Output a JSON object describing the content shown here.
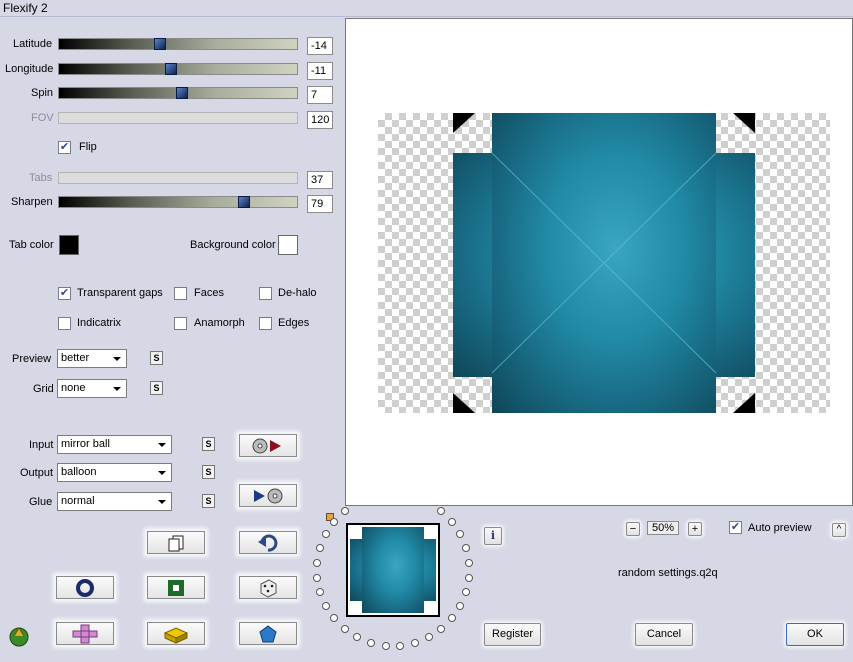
{
  "window": {
    "title": "Flexify 2"
  },
  "sliders": {
    "latitude": {
      "label": "Latitude",
      "value": "-14"
    },
    "longitude": {
      "label": "Longitude",
      "value": "-11"
    },
    "spin": {
      "label": "Spin",
      "value": "7"
    },
    "fov": {
      "label": "FOV",
      "value": "120"
    },
    "tabs": {
      "label": "Tabs",
      "value": "37"
    },
    "sharpen": {
      "label": "Sharpen",
      "value": "79"
    }
  },
  "flip": {
    "label": "Flip",
    "checked": true
  },
  "colors": {
    "tab_color_label": "Tab color",
    "tab_color": "#000000",
    "background_color_label": "Background color",
    "background_color": "#ffffff"
  },
  "options": {
    "transparent_gaps": "Transparent gaps",
    "faces": "Faces",
    "de_halo": "De-halo",
    "indicatrix": "Indicatrix",
    "anamorph": "Anamorph",
    "edges": "Edges"
  },
  "preview_select": {
    "label": "Preview",
    "value": "better"
  },
  "grid_select": {
    "label": "Grid",
    "value": "none"
  },
  "input_select": {
    "label": "Input",
    "value": "mirror ball"
  },
  "output_select": {
    "label": "Output",
    "value": "balloon"
  },
  "glue_select": {
    "label": "Glue",
    "value": "normal"
  },
  "s_button_label": "S",
  "zoom": {
    "minus": "−",
    "value": "50%",
    "plus": "+"
  },
  "auto_preview": {
    "label": "Auto preview",
    "checked": true
  },
  "collapse_button": "^",
  "info_button": "i",
  "preset_name": "random settings.q2q",
  "buttons": {
    "register": "Register",
    "cancel": "Cancel",
    "ok": "OK"
  },
  "accent_color": "#218aa6"
}
